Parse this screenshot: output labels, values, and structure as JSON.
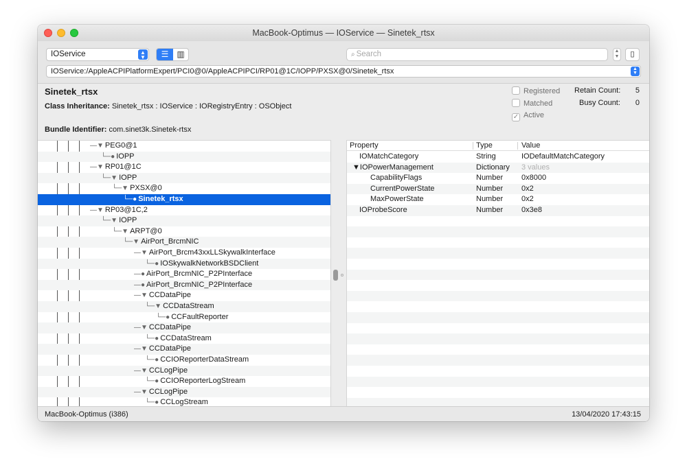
{
  "window": {
    "title": "MacBook-Optimus — IOService — Sinetek_rtsx"
  },
  "toolbar": {
    "plane_select": "IOService",
    "search_placeholder": "Search",
    "path": "IOService:/AppleACPIPlatformExpert/PCI0@0/AppleACPIPCI/RP01@1C/IOPP/PXSX@0/Sinetek_rtsx"
  },
  "info": {
    "name": "Sinetek_rtsx",
    "class_inheritance_label": "Class Inheritance:",
    "class_inheritance_value": "Sinetek_rtsx : IOService : IORegistryEntry : OSObject",
    "bundle_label": "Bundle Identifier:",
    "bundle_value": "com.sinet3k.Sinetek-rtsx",
    "checks": {
      "registered": "Registered",
      "matched": "Matched",
      "active": "Active"
    },
    "retain_label": "Retain Count:",
    "retain_value": "5",
    "busy_label": "Busy Count:",
    "busy_value": "0"
  },
  "tree": [
    {
      "label": "PEG0@1",
      "conn": "—▼"
    },
    {
      "label": "IOPP",
      "conn": "└─●"
    },
    {
      "label": "RP01@1C",
      "conn": "—▼"
    },
    {
      "label": "IOPP",
      "conn": "└─▼"
    },
    {
      "label": "PXSX@0",
      "conn": "└─▼"
    },
    {
      "label": "Sinetek_rtsx",
      "conn": "└─●"
    },
    {
      "label": "RP03@1C,2",
      "conn": "—▼"
    },
    {
      "label": "IOPP",
      "conn": "└─▼"
    },
    {
      "label": "ARPT@0",
      "conn": "└─▼"
    },
    {
      "label": "AirPort_BrcmNIC",
      "conn": "└─▼"
    },
    {
      "label": "AirPort_Brcm43xxLLSkywalkInterface",
      "conn": "—▼"
    },
    {
      "label": "IOSkywalkNetworkBSDClient",
      "conn": "└─●"
    },
    {
      "label": "AirPort_BrcmNIC_P2PInterface",
      "conn": "—●"
    },
    {
      "label": "AirPort_BrcmNIC_P2PInterface",
      "conn": "—●"
    },
    {
      "label": "CCDataPipe",
      "conn": "—▼"
    },
    {
      "label": "CCDataStream",
      "conn": "└─▼"
    },
    {
      "label": "CCFaultReporter",
      "conn": "└─●"
    },
    {
      "label": "CCDataPipe",
      "conn": "—▼"
    },
    {
      "label": "CCDataStream",
      "conn": "└─●"
    },
    {
      "label": "CCDataPipe",
      "conn": "—▼"
    },
    {
      "label": "CCIOReporterDataStream",
      "conn": "└─●"
    },
    {
      "label": "CCLogPipe",
      "conn": "—▼"
    },
    {
      "label": "CCIOReporterLogStream",
      "conn": "└─●"
    },
    {
      "label": "CCLogPipe",
      "conn": "—▼"
    },
    {
      "label": "CCLogStream",
      "conn": "└─●"
    }
  ],
  "props": {
    "headers": {
      "property": "Property",
      "type": "Type",
      "value": "Value"
    },
    "rows": [
      {
        "property": "IOMatchCategory",
        "type": "String",
        "value": "IODefaultMatchCategory"
      },
      {
        "property": "▼IOPowerManagement",
        "type": "Dictionary",
        "value": "3 values"
      },
      {
        "property": "CapabilityFlags",
        "type": "Number",
        "value": "0x8000"
      },
      {
        "property": "CurrentPowerState",
        "type": "Number",
        "value": "0x2"
      },
      {
        "property": "MaxPowerState",
        "type": "Number",
        "value": "0x2"
      },
      {
        "property": "IOProbeScore",
        "type": "Number",
        "value": "0x3e8"
      }
    ]
  },
  "status": {
    "left": "MacBook-Optimus (i386)",
    "right": "13/04/2020 17:43:15"
  }
}
